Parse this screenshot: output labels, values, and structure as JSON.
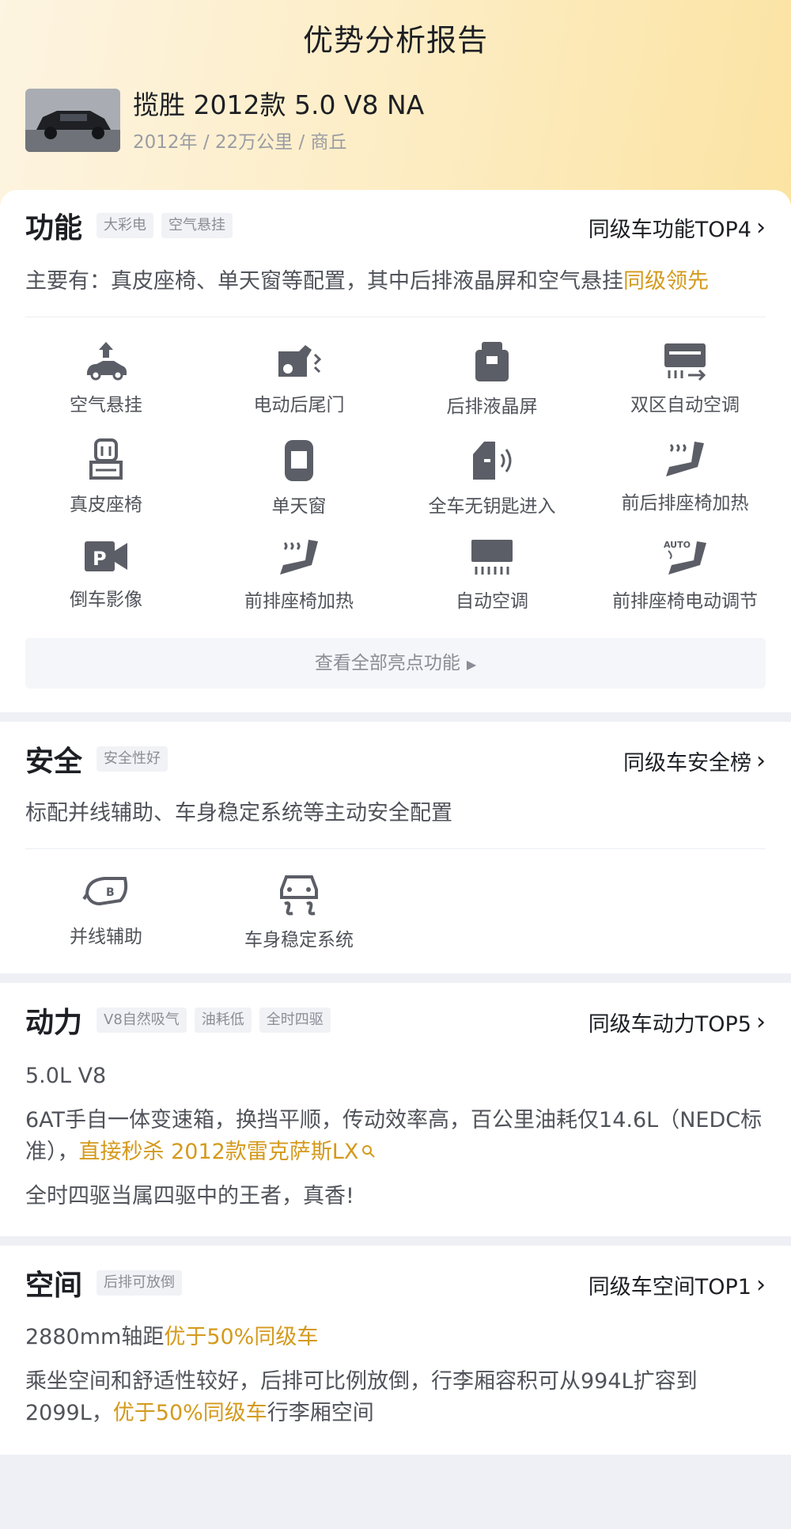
{
  "header": {
    "title": "优势分析报告",
    "car_title": "揽胜 2012款 5.0 V8 NA",
    "car_sub": "2012年 / 22万公里 / 商丘"
  },
  "function": {
    "title": "功能",
    "tags": [
      "大彩电",
      "空气悬挂"
    ],
    "rank": "同级车功能TOP4",
    "desc_main": "主要有：真皮座椅、单天窗等配置，其中后排液晶屏和空气悬挂",
    "desc_highlight": "同级领先",
    "features": [
      {
        "label": "空气悬挂",
        "icon": "air-suspension-icon"
      },
      {
        "label": "电动后尾门",
        "icon": "power-tailgate-icon"
      },
      {
        "label": "后排液晶屏",
        "icon": "rear-screen-icon"
      },
      {
        "label": "双区自动空调",
        "icon": "dual-zone-ac-icon"
      },
      {
        "label": "真皮座椅",
        "icon": "leather-seat-icon"
      },
      {
        "label": "单天窗",
        "icon": "sunroof-icon"
      },
      {
        "label": "全车无钥匙进入",
        "icon": "keyless-entry-icon"
      },
      {
        "label": "前后排座椅加热",
        "icon": "seat-heat-icon"
      },
      {
        "label": "倒车影像",
        "icon": "reverse-camera-icon"
      },
      {
        "label": "前排座椅加热",
        "icon": "front-seat-heat-icon"
      },
      {
        "label": "自动空调",
        "icon": "auto-ac-icon"
      },
      {
        "label": "前排座椅电动调节",
        "icon": "power-seat-icon"
      }
    ],
    "more_label": "查看全部亮点功能"
  },
  "safety": {
    "title": "安全",
    "tags": [
      "安全性好"
    ],
    "rank": "同级车安全榜",
    "desc": "标配并线辅助、车身稳定系统等主动安全配置",
    "features": [
      {
        "label": "并线辅助",
        "icon": "blind-spot-icon"
      },
      {
        "label": "车身稳定系统",
        "icon": "stability-control-icon"
      }
    ]
  },
  "power": {
    "title": "动力",
    "tags": [
      "V8自然吸气",
      "油耗低",
      "全时四驱"
    ],
    "rank": "同级车动力TOP5",
    "engine": "5.0L V8",
    "desc_main": "6AT手自一体变速箱，换挡平顺，传动效率高，百公里油耗仅14.6L（NEDC标准），",
    "desc_highlight": "直接秒杀 2012款雷克萨斯LX",
    "desc_4wd": "全时四驱当属四驱中的王者，真香!"
  },
  "space": {
    "title": "空间",
    "tags": [
      "后排可放倒"
    ],
    "rank": "同级车空间TOP1",
    "wheelbase": "2880mm轴距",
    "wheelbase_highlight": "优于50%同级车",
    "desc_main": "乘坐空间和舒适性较好，后排可比例放倒，行李厢容积可从994L扩容到2099L，",
    "desc_highlight": "优于50%同级车",
    "desc_tail": "行李厢空间"
  },
  "colors": {
    "accent": "#d49a1c",
    "header_gradient_start": "#fdf4e1",
    "header_gradient_end": "#fbe3a2",
    "icon": "#5b5e66"
  }
}
